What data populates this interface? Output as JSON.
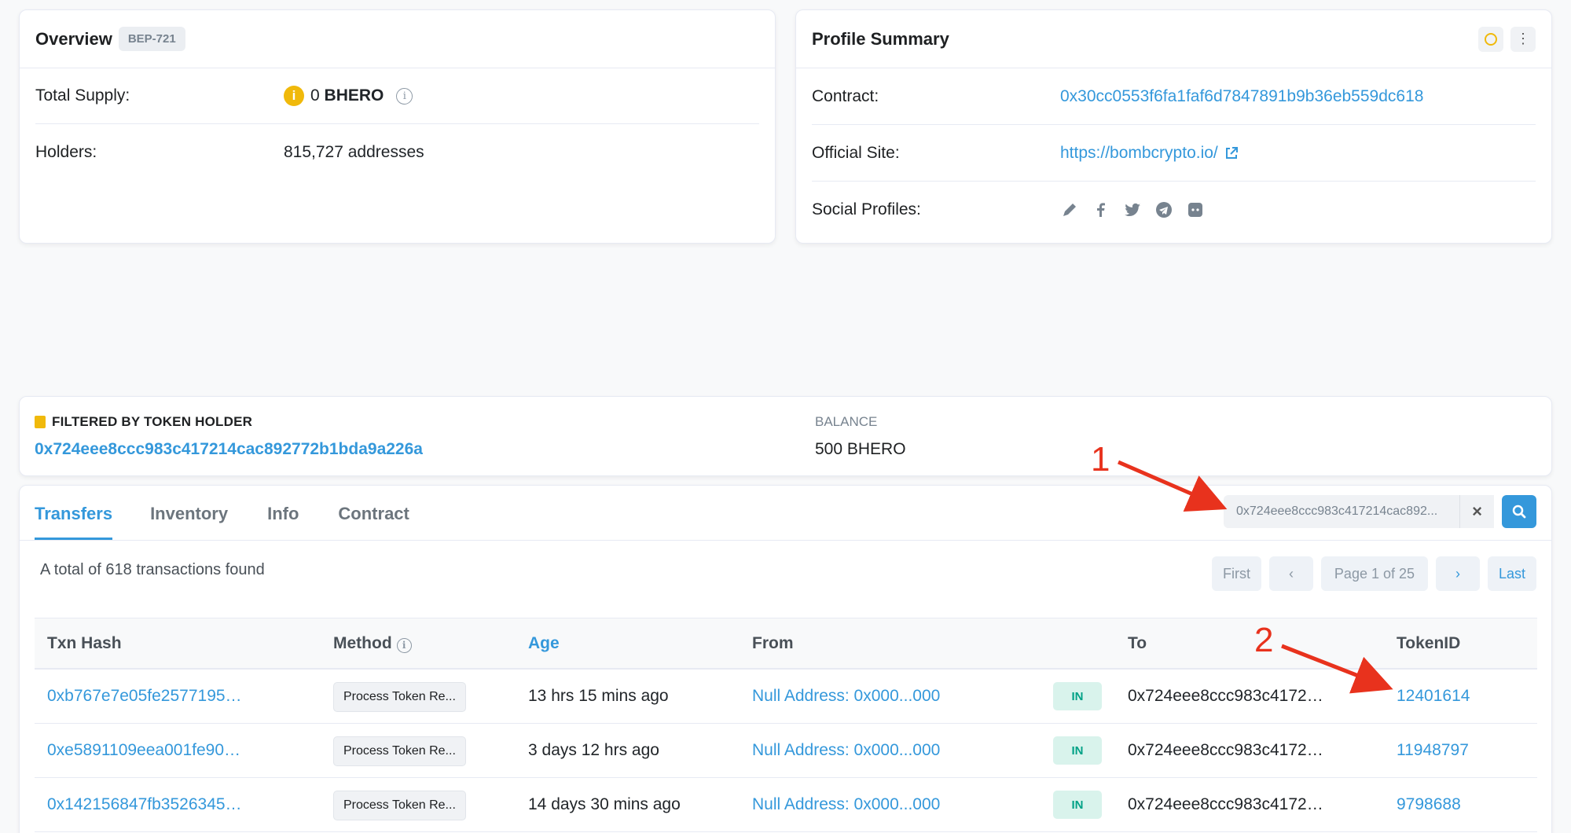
{
  "overview": {
    "title": "Overview",
    "badge": "BEP-721",
    "total_supply_label": "Total Supply:",
    "total_supply_value": "0",
    "total_supply_symbol": "BHERO",
    "holders_label": "Holders:",
    "holders_value": "815,727 addresses"
  },
  "profile": {
    "title": "Profile Summary",
    "contract_label": "Contract:",
    "contract_value": "0x30cc0553f6fa1faf6d7847891b9b36eb559dc618",
    "site_label": "Official Site:",
    "site_value": "https://bombcrypto.io/",
    "social_label": "Social Profiles:",
    "social_icons": [
      "pencil-icon",
      "facebook-icon",
      "twitter-icon",
      "telegram-icon",
      "discord-icon"
    ]
  },
  "filter": {
    "label": "FILTERED BY TOKEN HOLDER",
    "address": "0x724eee8ccc983c417214cac892772b1bda9a226a",
    "balance_label": "BALANCE",
    "balance_value": "500 BHERO"
  },
  "tabs": [
    {
      "label": "Transfers",
      "active": true
    },
    {
      "label": "Inventory",
      "active": false
    },
    {
      "label": "Info",
      "active": false
    },
    {
      "label": "Contract",
      "active": false
    }
  ],
  "search": {
    "value": "0x724eee8ccc983c417214cac892..."
  },
  "summary": "A total of 618 transactions found",
  "pager": {
    "first": "First",
    "page": "Page 1 of 25",
    "last": "Last"
  },
  "columns": {
    "hash": "Txn Hash",
    "method": "Method",
    "age": "Age",
    "from": "From",
    "to": "To",
    "token": "TokenID"
  },
  "rows": [
    {
      "hash": "0xb767e7e05fe2577195…",
      "method": "Process Token Re...",
      "age": "13 hrs 15 mins ago",
      "from": "Null Address: 0x000...000",
      "dir": "IN",
      "to": "0x724eee8ccc983c4172…",
      "token": "12401614"
    },
    {
      "hash": "0xe5891109eea001fe90…",
      "method": "Process Token Re...",
      "age": "3 days 12 hrs ago",
      "from": "Null Address: 0x000...000",
      "dir": "IN",
      "to": "0x724eee8ccc983c4172…",
      "token": "11948797"
    },
    {
      "hash": "0x142156847fb3526345…",
      "method": "Process Token Re...",
      "age": "14 days 30 mins ago",
      "from": "Null Address: 0x000...000",
      "dir": "IN",
      "to": "0x724eee8ccc983c4172…",
      "token": "9798688"
    }
  ],
  "annotations": [
    "1",
    "2"
  ],
  "colors": {
    "link": "#3498db",
    "annotation": "#e8321d",
    "in_badge": "#00a186",
    "coin": "#f0b90b"
  }
}
